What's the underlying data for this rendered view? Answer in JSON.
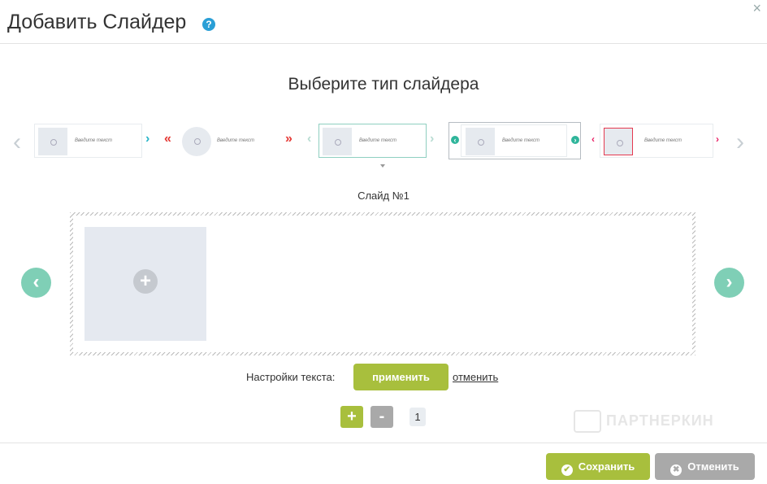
{
  "header": {
    "title": "Добавить Слайдер",
    "help_icon": "?",
    "close_icon": "×"
  },
  "picker": {
    "heading": "Выберите тип слайдера",
    "prev_icon": "‹",
    "next_icon": "›",
    "placeholder_text": "Введите текст",
    "types": [
      {
        "id": "type-1",
        "arrow_left": "",
        "arrow_right": "›",
        "arrow_color": "#28b4c8"
      },
      {
        "id": "type-2",
        "arrow_left": "«",
        "arrow_right": "»",
        "arrow_color": "#e53935"
      },
      {
        "id": "type-3",
        "arrow_left": "‹",
        "arrow_right": "›",
        "arrow_color": "#b8dcd2"
      },
      {
        "id": "type-4",
        "arrow_left": "‹",
        "arrow_right": "›",
        "arrow_color": "#2fb59b"
      },
      {
        "id": "type-5",
        "arrow_left": "‹",
        "arrow_right": "›",
        "arrow_color": "#e91e63"
      }
    ]
  },
  "slide": {
    "label": "Слайд №1",
    "add_icon": "+",
    "prev_icon": "‹",
    "next_icon": "›"
  },
  "text_settings": {
    "label": "Настройки текста:",
    "apply_label": "применить",
    "cancel_label": "отменить"
  },
  "counter": {
    "plus_label": "+",
    "minus_label": "-",
    "value": "1"
  },
  "watermark": "ПАРТНЕРКИН",
  "footer": {
    "save_label": "Сохранить",
    "save_icon": "✔",
    "cancel_label": "Отменить",
    "cancel_icon": "✖"
  },
  "colors": {
    "accent_green": "#a8bf3d",
    "nav_teal": "#7fcfb6",
    "gray_button": "#a9a9a9",
    "help_blue": "#2a9fd6"
  }
}
